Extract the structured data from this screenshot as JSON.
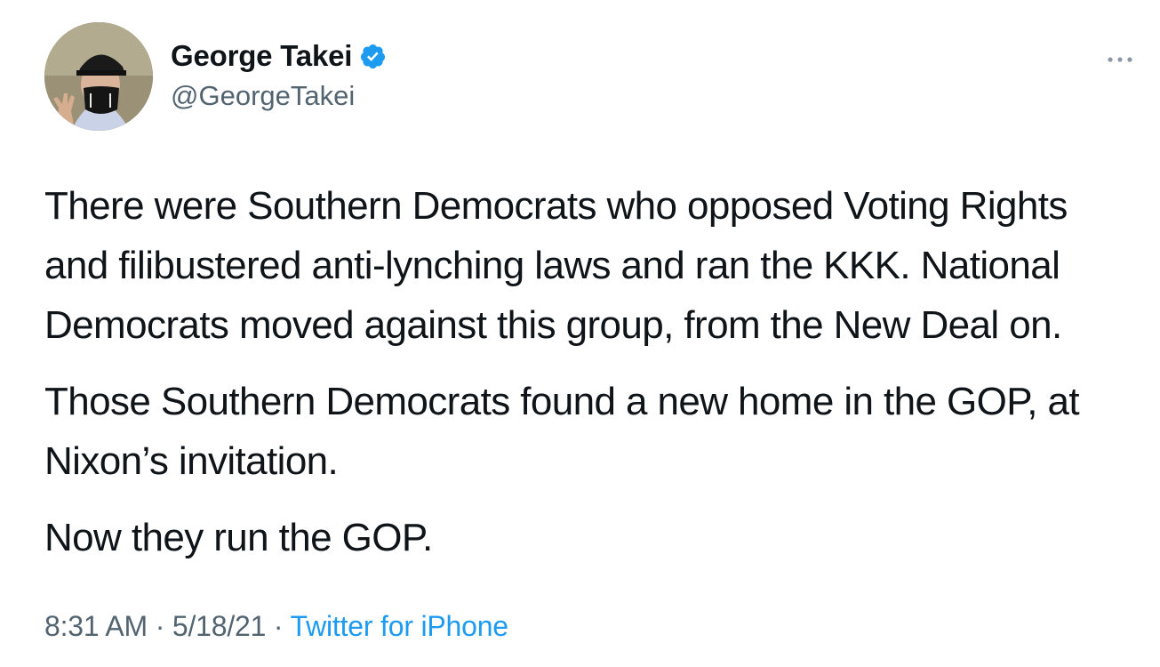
{
  "author": {
    "display_name": "George Takei",
    "handle": "@GeorgeTakei",
    "verified_icon": "verified-badge-icon",
    "avatar_icon": "profile-photo"
  },
  "menu_icon": "more-options-icon",
  "tweet": {
    "paragraphs": [
      "There were Southern Democrats who opposed Voting Rights\nand filibustered anti-lynching laws and ran the KKK. National\nDemocrats moved against this group, from the New Deal on.",
      "Those Southern Democrats found a new home in the GOP, at\nNixon’s invitation.",
      "Now they run the GOP."
    ]
  },
  "meta": {
    "time": "8:31 AM",
    "separator": " · ",
    "date": "5/18/21",
    "source": "Twitter for iPhone"
  },
  "colors": {
    "text": "#0f1419",
    "secondary": "#536471",
    "accent": "#1d9bf0"
  }
}
